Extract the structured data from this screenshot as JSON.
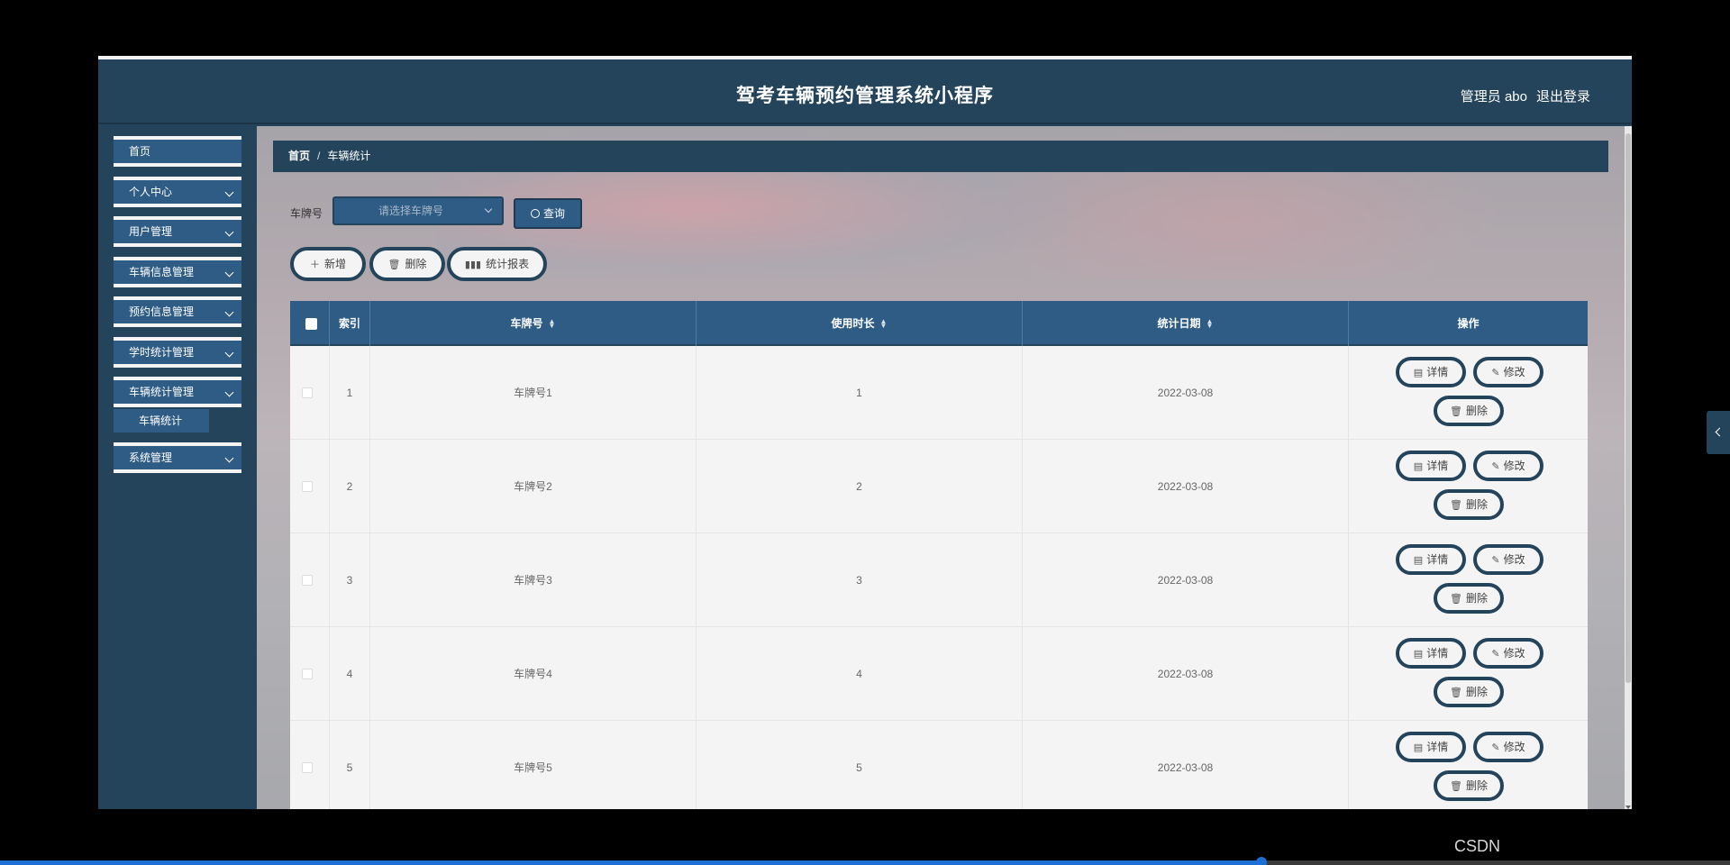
{
  "header": {
    "title": "驾考车辆预约管理系统小程序",
    "user": "管理员 abo",
    "logout": "退出登录"
  },
  "sidebar": {
    "items": [
      {
        "label": "首页"
      },
      {
        "label": "个人中心"
      },
      {
        "label": "用户管理"
      },
      {
        "label": "车辆信息管理"
      },
      {
        "label": "预约信息管理"
      },
      {
        "label": "学时统计管理"
      },
      {
        "label": "车辆统计管理"
      },
      {
        "label": "系统管理"
      }
    ],
    "active_sub": "车辆统计"
  },
  "breadcrumb": {
    "home": "首页",
    "sep": "/",
    "current": "车辆统计"
  },
  "search": {
    "label": "车牌号",
    "placeholder": "请选择车牌号",
    "query_label": "查询"
  },
  "toolbar": {
    "add": "新增",
    "delete": "删除",
    "report": "统计报表"
  },
  "table": {
    "columns": [
      "索引",
      "车牌号",
      "使用时长",
      "统计日期",
      "操作"
    ],
    "rows": [
      {
        "index": "1",
        "plate": "车牌号1",
        "duration": "1",
        "date": "2022-03-08"
      },
      {
        "index": "2",
        "plate": "车牌号2",
        "duration": "2",
        "date": "2022-03-08"
      },
      {
        "index": "3",
        "plate": "车牌号3",
        "duration": "3",
        "date": "2022-03-08"
      },
      {
        "index": "4",
        "plate": "车牌号4",
        "duration": "4",
        "date": "2022-03-08"
      },
      {
        "index": "5",
        "plate": "车牌号5",
        "duration": "5",
        "date": "2022-03-08"
      }
    ],
    "actions": {
      "detail": "详情",
      "edit": "修改",
      "delete": "删除"
    }
  },
  "watermark": "CSDN",
  "colors": {
    "primary": "#24445c",
    "accent": "#2e5c85",
    "row_bg": "#f4f4f4"
  }
}
